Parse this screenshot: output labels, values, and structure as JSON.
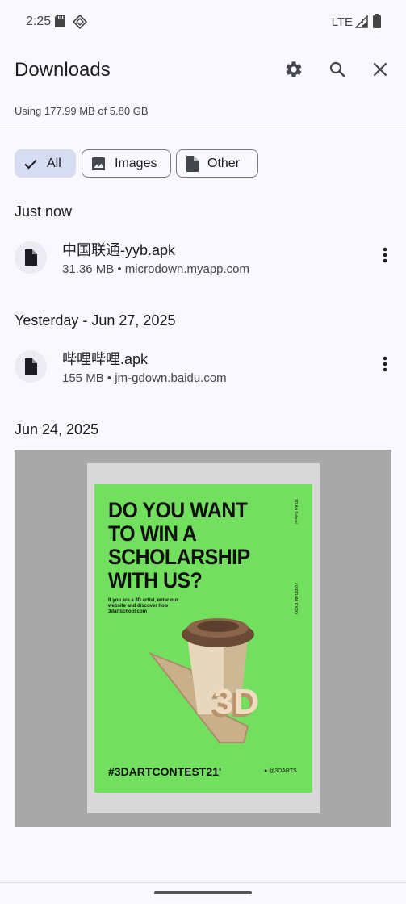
{
  "status_bar": {
    "time": "2:25",
    "network": "LTE",
    "icons": [
      "sd-card-icon",
      "vpn-diamond-icon",
      "signal-icon",
      "battery-icon"
    ]
  },
  "app_bar": {
    "title": "Downloads",
    "actions": [
      "settings-gear-icon",
      "search-icon",
      "close-icon"
    ]
  },
  "storage": {
    "text": "Using 177.99 MB of 5.80 GB"
  },
  "filters": {
    "all": "All",
    "images": "Images",
    "other": "Other",
    "selected": "All"
  },
  "sections": [
    {
      "header": "Just now",
      "items": [
        {
          "name": "中国联通-yyb.apk",
          "meta": "31.36 MB • microdown.myapp.com",
          "icon": "file-icon"
        }
      ]
    },
    {
      "header": "Yesterday - Jun 27, 2025",
      "items": [
        {
          "name": "哔哩哔哩.apk",
          "meta": "155 MB • jm-gdown.baidu.com",
          "icon": "file-icon"
        }
      ]
    },
    {
      "header": "Jun 24, 2025",
      "image": {
        "headline": "DO YOU WANT\nTO WIN A\nSCHOLARSHIP\nWITH US?",
        "sub": "If you are a 3D artist, enter our website and discover how 3dartschool.com",
        "side_top": "3D Art School",
        "side_bottom": "/ VIRTUAL EXPO",
        "badge": "3D",
        "hashtag": "#3DARTCONTEST21'",
        "handle": "● @3DARTS"
      }
    }
  ],
  "colors": {
    "background": "#f9f8fe",
    "chip_selected": "#d6dcf2",
    "poster_green": "#72e05e",
    "thumb_bg": "#a8a8a8"
  }
}
